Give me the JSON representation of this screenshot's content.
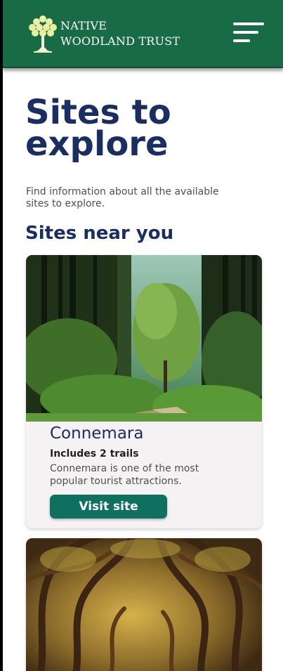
{
  "header": {
    "brand_line1": "NATIVE",
    "brand_line2": "WOODLAND TRUST",
    "logo_icon": "tree-icon",
    "menu_icon": "hamburger-menu-icon"
  },
  "page": {
    "title_line1": "Sites to",
    "title_line2": "explore",
    "intro_line1": "Find information about all the available",
    "intro_line2": "sites to explore.",
    "section_title": "Sites near you"
  },
  "sites": [
    {
      "image": "forest-path-photo",
      "name": "Connemara",
      "trails": "Includes 2 trails",
      "desc_line1": "Connemara is one of the most",
      "desc_line2": "popular tourist attractions.",
      "button_label": "Visit site"
    },
    {
      "image": "twisted-trees-photo"
    }
  ],
  "colors": {
    "header_bg": "#176b45",
    "title": "#1a2e63",
    "button_bg": "#0f7060",
    "card_bg": "#f4f2f3"
  }
}
